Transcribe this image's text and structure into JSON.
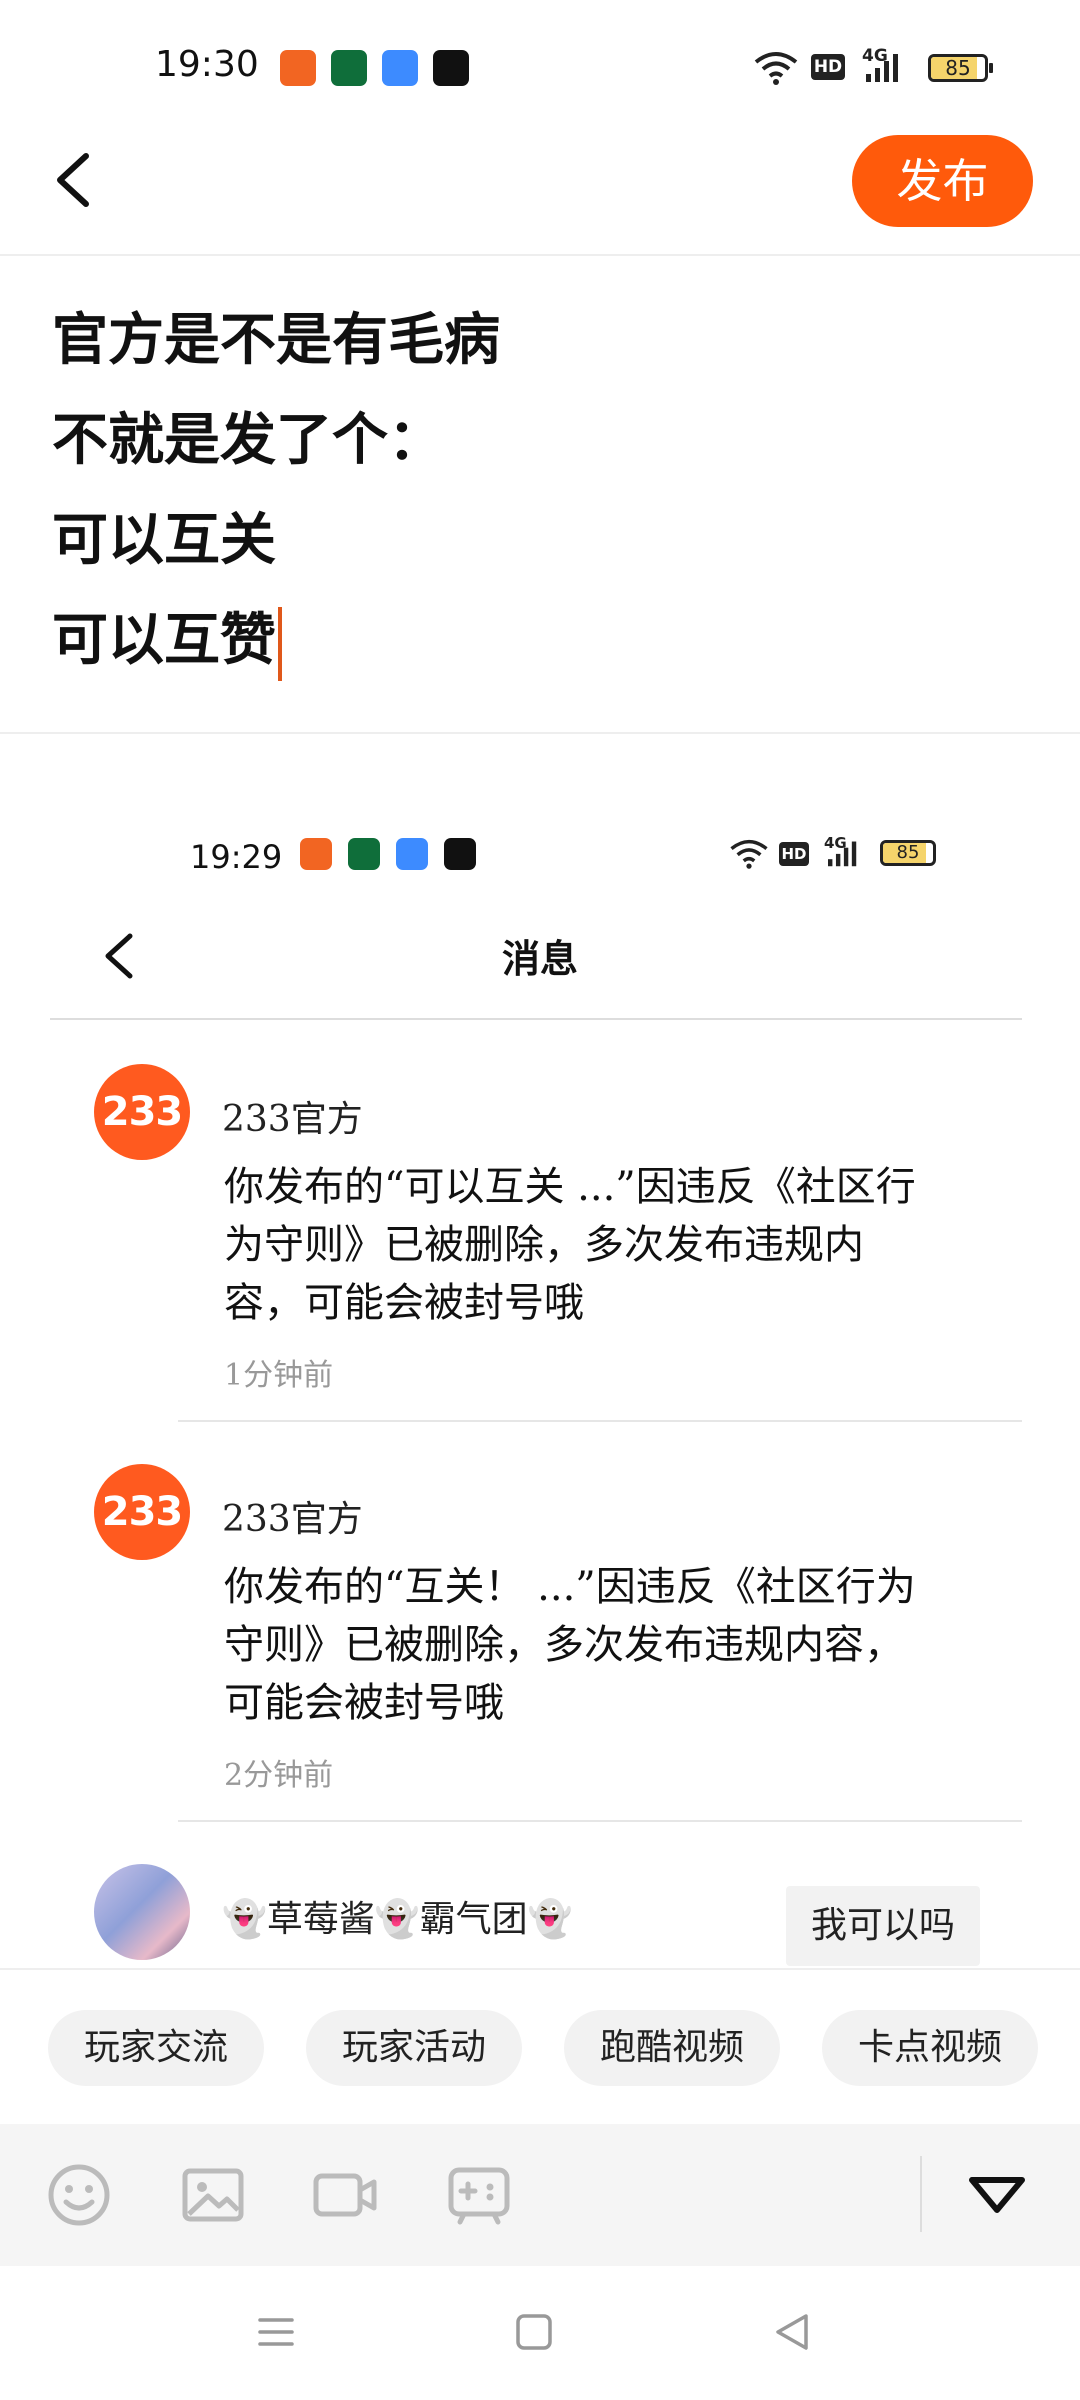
{
  "status_bar": {
    "time": "19:30",
    "battery": "85",
    "battery_level": 0.85,
    "signal": "4G",
    "hd_label": "HD"
  },
  "top_bar": {
    "back_icon": "chevron-left-icon",
    "publish_label": "发布"
  },
  "post": {
    "lines": [
      "官方是不是有毛病",
      "不就是发了个：",
      "可以互关",
      "可以互赞"
    ]
  },
  "embedded_screenshot": {
    "status_bar": {
      "time": "19:29",
      "battery": "85",
      "battery_level": 0.85,
      "signal": "4G",
      "hd_label": "HD"
    },
    "title": "消息",
    "messages": [
      {
        "avatar_text": "233",
        "sender": "233官方",
        "text": "你发布的“可以互关 ...”因违反《社区行为守则》已被删除，多次发布违规内容，可能会被封号哦",
        "time": "1分钟前"
      },
      {
        "avatar_text": "233",
        "sender": "233官方",
        "text": "你发布的“互关！ ...”因违反《社区行为守则》已被删除，多次发布违规内容，可能会被封号哦",
        "time": "2分钟前"
      },
      {
        "sender": "👻草莓酱👻霸气团👻",
        "preview": "我可以吗"
      }
    ]
  },
  "tags": [
    "玩家交流",
    "玩家活动",
    "跑酷视频",
    "卡点视频"
  ],
  "toolbar": {
    "icons": [
      "emoji-icon",
      "image-icon",
      "video-icon",
      "gamepad-icon",
      "collapse-icon"
    ]
  },
  "colors": {
    "accent": "#ff5a0b",
    "avatar_orange": "#ff5a1f",
    "caret": "#e0581a"
  }
}
